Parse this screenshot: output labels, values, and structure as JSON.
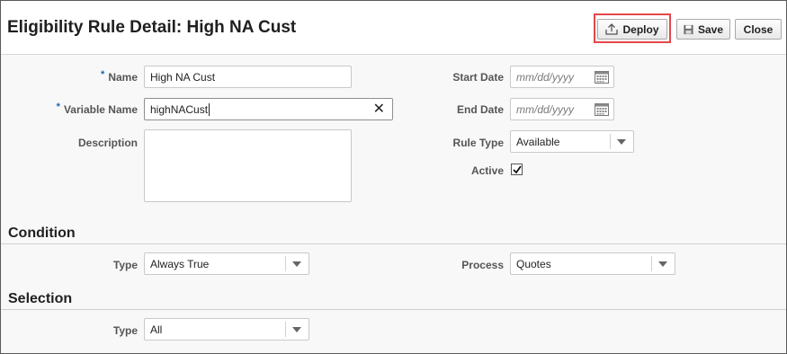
{
  "header": {
    "title": "Eligibility Rule Detail: High NA Cust",
    "buttons": {
      "deploy": "Deploy",
      "save": "Save",
      "close": "Close"
    }
  },
  "form": {
    "name": {
      "label": "Name",
      "value": "High NA Cust",
      "required": "*"
    },
    "variable_name": {
      "label": "Variable Name",
      "value": "highNACust",
      "required": "*"
    },
    "description": {
      "label": "Description",
      "value": ""
    },
    "start_date": {
      "label": "Start Date",
      "placeholder": "mm/dd/yyyy"
    },
    "end_date": {
      "label": "End Date",
      "placeholder": "mm/dd/yyyy"
    },
    "rule_type": {
      "label": "Rule Type",
      "value": "Available"
    },
    "active": {
      "label": "Active",
      "checked": true
    }
  },
  "condition": {
    "title": "Condition",
    "type": {
      "label": "Type",
      "value": "Always True"
    },
    "process": {
      "label": "Process",
      "value": "Quotes"
    }
  },
  "selection": {
    "title": "Selection",
    "type": {
      "label": "Type",
      "value": "All"
    }
  },
  "colors": {
    "highlight": "#e2474b",
    "required_marker": "#1d64b5"
  }
}
